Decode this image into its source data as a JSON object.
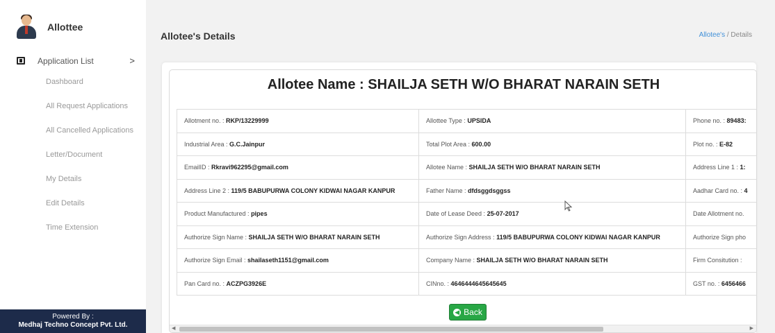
{
  "sidebar": {
    "user_label": "Allottee",
    "nav_main": "Application List",
    "nav_arrow": ">",
    "sub_items": [
      "Dashboard",
      "All Request Applications",
      "All Cancelled Applications",
      "Letter/Document",
      "My Details",
      "Edit Details",
      "Time Extension"
    ],
    "powered_by": "Powered By :",
    "company": "Medhaj Techno Concept Pvt. Ltd."
  },
  "header": {
    "title": "Allotee's Details",
    "breadcrumb_link": "Allotee's",
    "breadcrumb_sep": " / ",
    "breadcrumb_current": "Details"
  },
  "card": {
    "heading": "Allotee Name : SHAILJA SETH W/O BHARAT NARAIN SETH",
    "rows": [
      [
        {
          "label": "Allotment no. : ",
          "value": "RKP/13229999"
        },
        {
          "label": "Allottee Type : ",
          "value": "UPSIDA"
        },
        {
          "label": "Phone no. : ",
          "value": "89483:"
        }
      ],
      [
        {
          "label": "Industrial Area : ",
          "value": "G.C.Jainpur"
        },
        {
          "label": "Total Plot Area : ",
          "value": "600.00"
        },
        {
          "label": "Plot no. : ",
          "value": "E-82"
        }
      ],
      [
        {
          "label": "EmailID : ",
          "value": "Rkravi962295@gmail.com"
        },
        {
          "label": "Allotee Name : ",
          "value": "SHAILJA SETH W/O BHARAT NARAIN SETH"
        },
        {
          "label": "Address Line 1 : ",
          "value": "1:"
        }
      ],
      [
        {
          "label": "Address Line 2 : ",
          "value": "119/5 BABUPURWA COLONY KIDWAI NAGAR KANPUR"
        },
        {
          "label": "Father Name : ",
          "value": "dfdsggdsggss"
        },
        {
          "label": "Aadhar Card no. : ",
          "value": "4"
        }
      ],
      [
        {
          "label": "Product Manufactured : ",
          "value": "pipes"
        },
        {
          "label": "Date of Lease Deed : ",
          "value": "25-07-2017"
        },
        {
          "label": "Date Allotment no.",
          "value": ""
        }
      ],
      [
        {
          "label": "Authorize Sign Name : ",
          "value": "SHAILJA SETH W/O BHARAT NARAIN SETH"
        },
        {
          "label": "Authorize Sign Address : ",
          "value": "119/5 BABUPURWA COLONY KIDWAI NAGAR KANPUR"
        },
        {
          "label": "Authorize Sign pho",
          "value": ""
        }
      ],
      [
        {
          "label": "Authorize Sign Email : ",
          "value": "shailaseth1151@gmail.com"
        },
        {
          "label": "Company Name : ",
          "value": "SHAILJA SETH W/O BHARAT NARAIN SETH"
        },
        {
          "label": "Firm Consitution : ",
          "value": ""
        }
      ],
      [
        {
          "label": "Pan Card no. : ",
          "value": "ACZPG3926E"
        },
        {
          "label": "CINno. : ",
          "value": "4646444645645645"
        },
        {
          "label": "GST no. : ",
          "value": "6456466"
        }
      ]
    ],
    "back_label": "Back",
    "back_icon": "left-arrow-circle-icon"
  },
  "colors": {
    "sidebar_footer": "#1d2b4a",
    "back_button": "#28a745",
    "breadcrumb_link": "#3f8fd8"
  }
}
